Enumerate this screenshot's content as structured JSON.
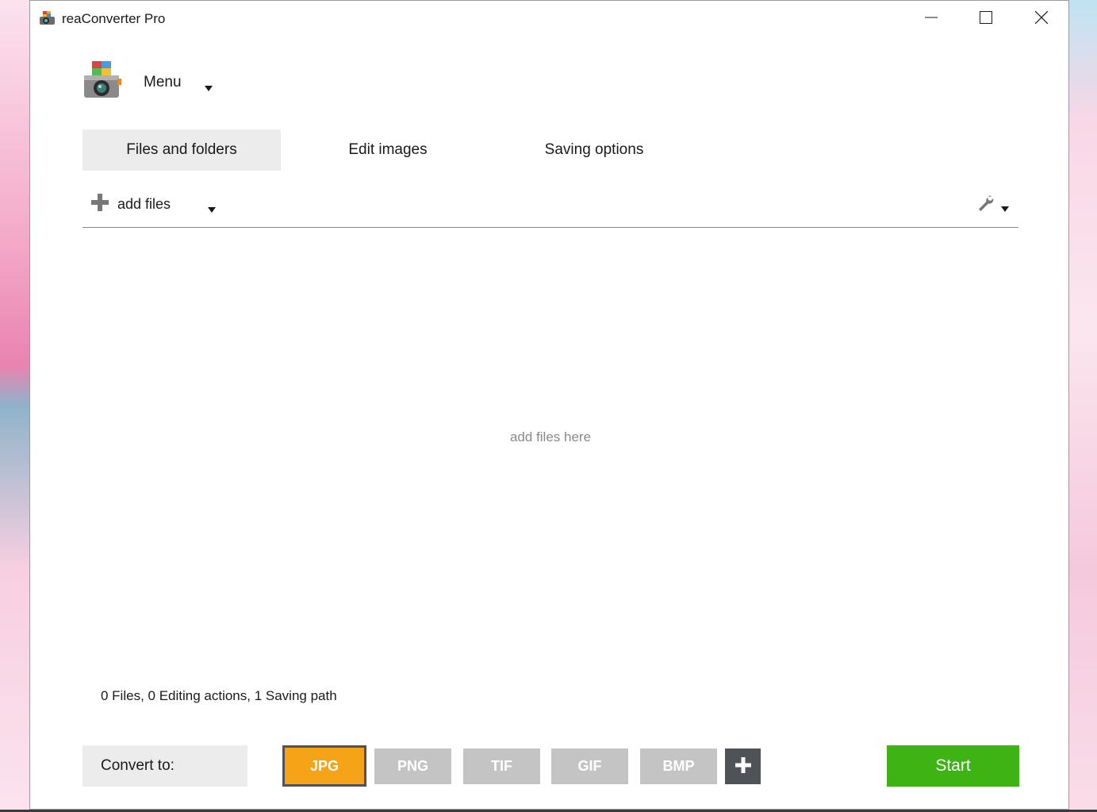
{
  "window": {
    "title": "reaConverter Pro",
    "icons": {
      "app": "camera-app-icon",
      "minimize": "minimize-icon",
      "maximize": "maximize-icon",
      "close": "close-icon"
    }
  },
  "menu": {
    "label": "Menu",
    "icon": "camera-logo-icon"
  },
  "tabs": [
    {
      "label": "Files and folders",
      "active": true
    },
    {
      "label": "Edit images",
      "active": false
    },
    {
      "label": "Saving options",
      "active": false
    }
  ],
  "toolbar": {
    "add_files_label": "add files",
    "icons": {
      "add": "plus-icon",
      "settings": "wrench-icon"
    }
  },
  "dropzone": {
    "text": "add files here"
  },
  "status": {
    "text": "0 Files, 0 Editing actions, 1 Saving path"
  },
  "convert": {
    "label": "Convert to:",
    "formats": [
      "JPG",
      "PNG",
      "TIF",
      "GIF",
      "BMP"
    ],
    "selected": "JPG",
    "add_icon": "plus-icon"
  },
  "start": {
    "label": "Start"
  },
  "colors": {
    "selected_format": "#f5a418",
    "start_button": "#3db314",
    "format_button": "#c4c4c4",
    "dark_button": "#4f5257"
  }
}
